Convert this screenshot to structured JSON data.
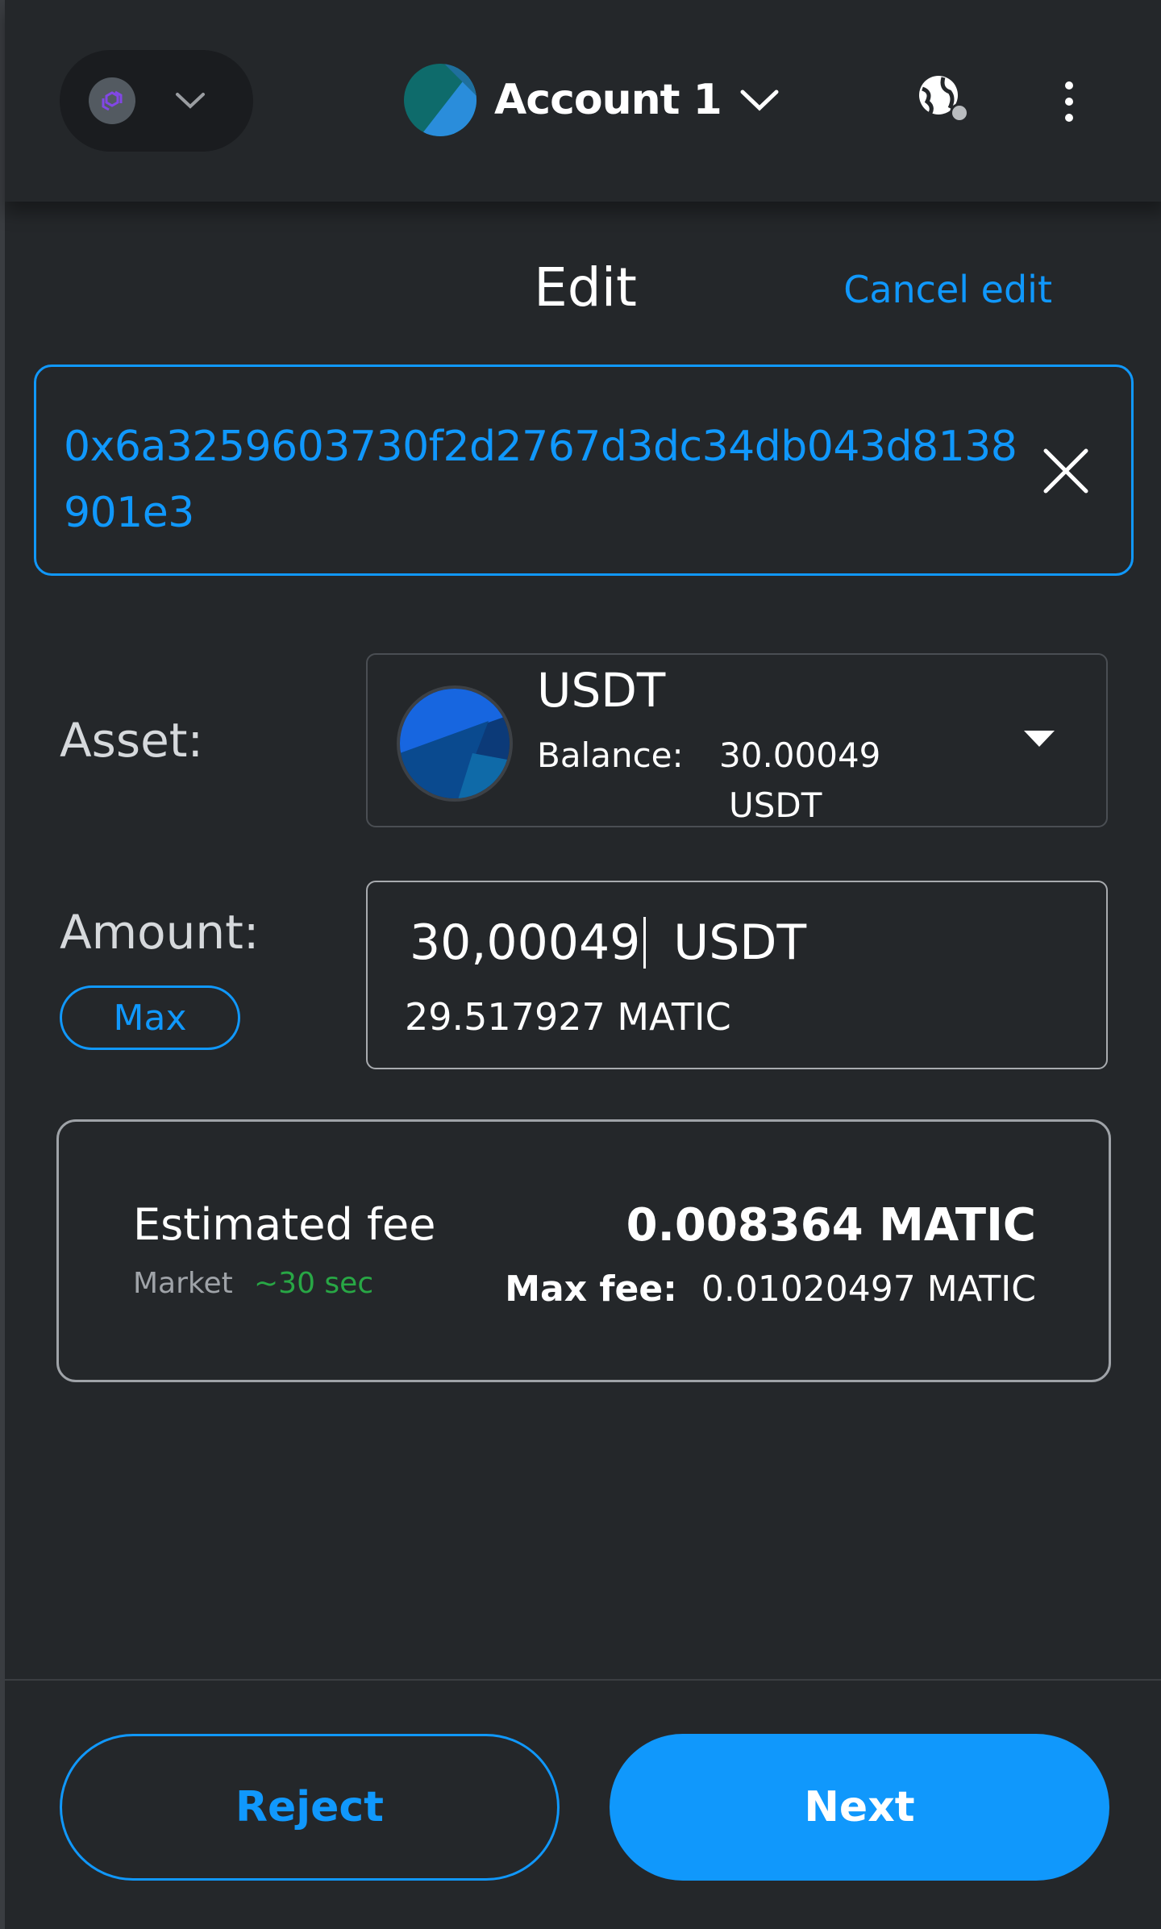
{
  "header": {
    "network_icon": "polygon-icon",
    "account_name": "Account 1",
    "connected_sites_icon": "globe-icon",
    "menu_icon": "kebab-menu-icon"
  },
  "edit": {
    "title": "Edit",
    "cancel_label": "Cancel edit"
  },
  "recipient": {
    "address": "0x6a3259603730f2d2767d3dc34db043d8138901e3",
    "clear_icon": "close-icon"
  },
  "asset": {
    "label": "Asset:",
    "symbol": "USDT",
    "balance_label": "Balance:",
    "balance_value": "30.00049",
    "balance_unit": "USDT"
  },
  "amount": {
    "label": "Amount:",
    "max_label": "Max",
    "value": "30,00049",
    "unit": "USDT",
    "converted": "29.517927 MATIC"
  },
  "fee": {
    "label": "Estimated fee",
    "speed": "Market",
    "time": "~30 sec",
    "amount": "0.008364 MATIC",
    "max_label": "Max fee:",
    "max_value": "0.01020497 MATIC"
  },
  "footer": {
    "reject_label": "Reject",
    "next_label": "Next"
  },
  "colors": {
    "background": "#24272a",
    "accent": "#1098fc",
    "success": "#28a745"
  }
}
